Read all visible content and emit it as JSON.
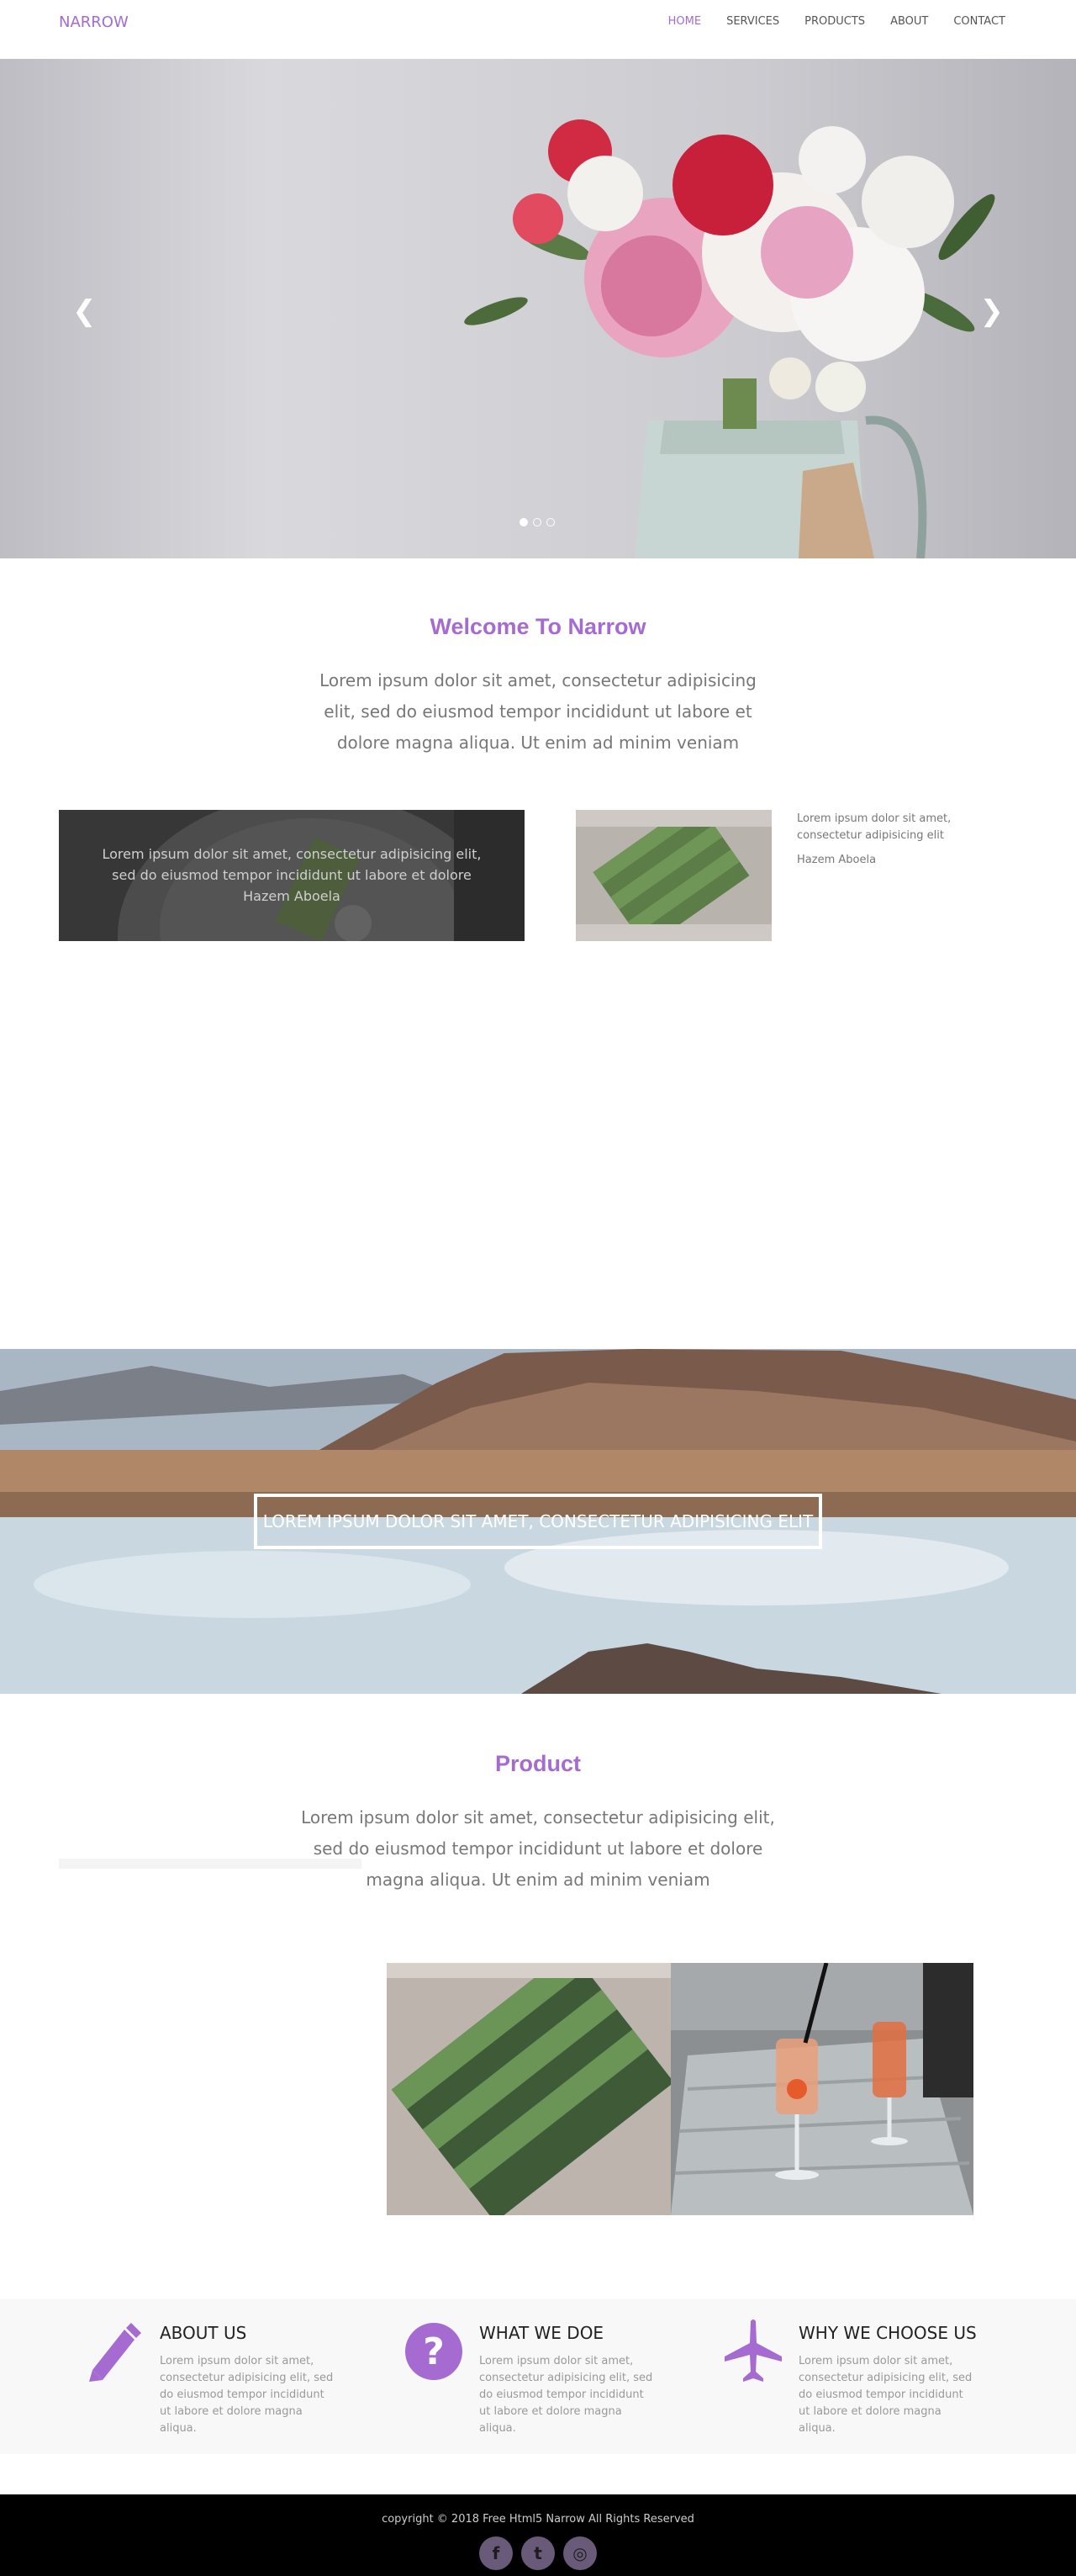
{
  "brand": "NARROW",
  "nav": [
    {
      "label": "HOME",
      "active": true
    },
    {
      "label": "SERVICES",
      "active": false
    },
    {
      "label": "PRODUCTS",
      "active": false
    },
    {
      "label": "ABOUT",
      "active": false
    },
    {
      "label": "CONTACT",
      "active": false
    }
  ],
  "hero": {
    "prev_icon": "chevron-left-icon",
    "next_icon": "chevron-right-icon",
    "prev_glyph": "❮",
    "next_glyph": "❯",
    "slide_count": 3,
    "active_slide": 1
  },
  "welcome": {
    "title": "Welcome To Narrow",
    "text": "Lorem ipsum dolor sit amet, consectetur adipisicing elit, sed do eiusmod tempor incididunt ut labore et dolore magna aliqua. Ut enim ad minim veniam"
  },
  "testimonial_overlay": {
    "text": "Lorem ipsum dolor sit amet, consectetur adipisicing elit, sed do eiusmod tempor incididunt ut labore et dolore",
    "author": "Hazem Aboela"
  },
  "testimonial_side": {
    "text": "Lorem ipsum dolor sit amet, consectetur adipisicing elit",
    "author": "Hazem Aboela"
  },
  "banner": {
    "text": "LOREM IPSUM DOLOR SIT AMET, CONSECTETUR ADIPISICING ELIT"
  },
  "product": {
    "title": "Product",
    "text": "Lorem ipsum dolor sit amet, consectetur adipisicing elit, sed do eiusmod tempor incididunt ut labore et dolore magna aliqua. Ut enim ad minim veniam"
  },
  "features": [
    {
      "icon": "pencil-icon",
      "title": "ABOUT US",
      "text": "Lorem ipsum dolor sit amet, consectetur adipisicing elit, sed do eiusmod tempor incididunt ut labore et dolore magna aliqua."
    },
    {
      "icon": "question-icon",
      "title": "WHAT WE DOE",
      "text": "Lorem ipsum dolor sit amet, consectetur adipisicing elit, sed do eiusmod tempor incididunt ut labore et dolore magna aliqua."
    },
    {
      "icon": "plane-icon",
      "title": "WHY WE CHOOSE US",
      "text": "Lorem ipsum dolor sit amet, consectetur adipisicing elit, sed do eiusmod tempor incididunt ut labore et dolore magna aliqua."
    }
  ],
  "footer": {
    "copyright": "copyright © 2018 Free Html5 Narrow All Rights Reserved",
    "social": [
      {
        "icon": "facebook-icon",
        "glyph": "f"
      },
      {
        "icon": "twitter-icon",
        "glyph": "t"
      },
      {
        "icon": "instagram-icon",
        "glyph": "◎"
      }
    ]
  },
  "colors": {
    "accent": "#a56bd1",
    "footer_bg": "#000000",
    "features_bg": "#f8f8f8"
  }
}
